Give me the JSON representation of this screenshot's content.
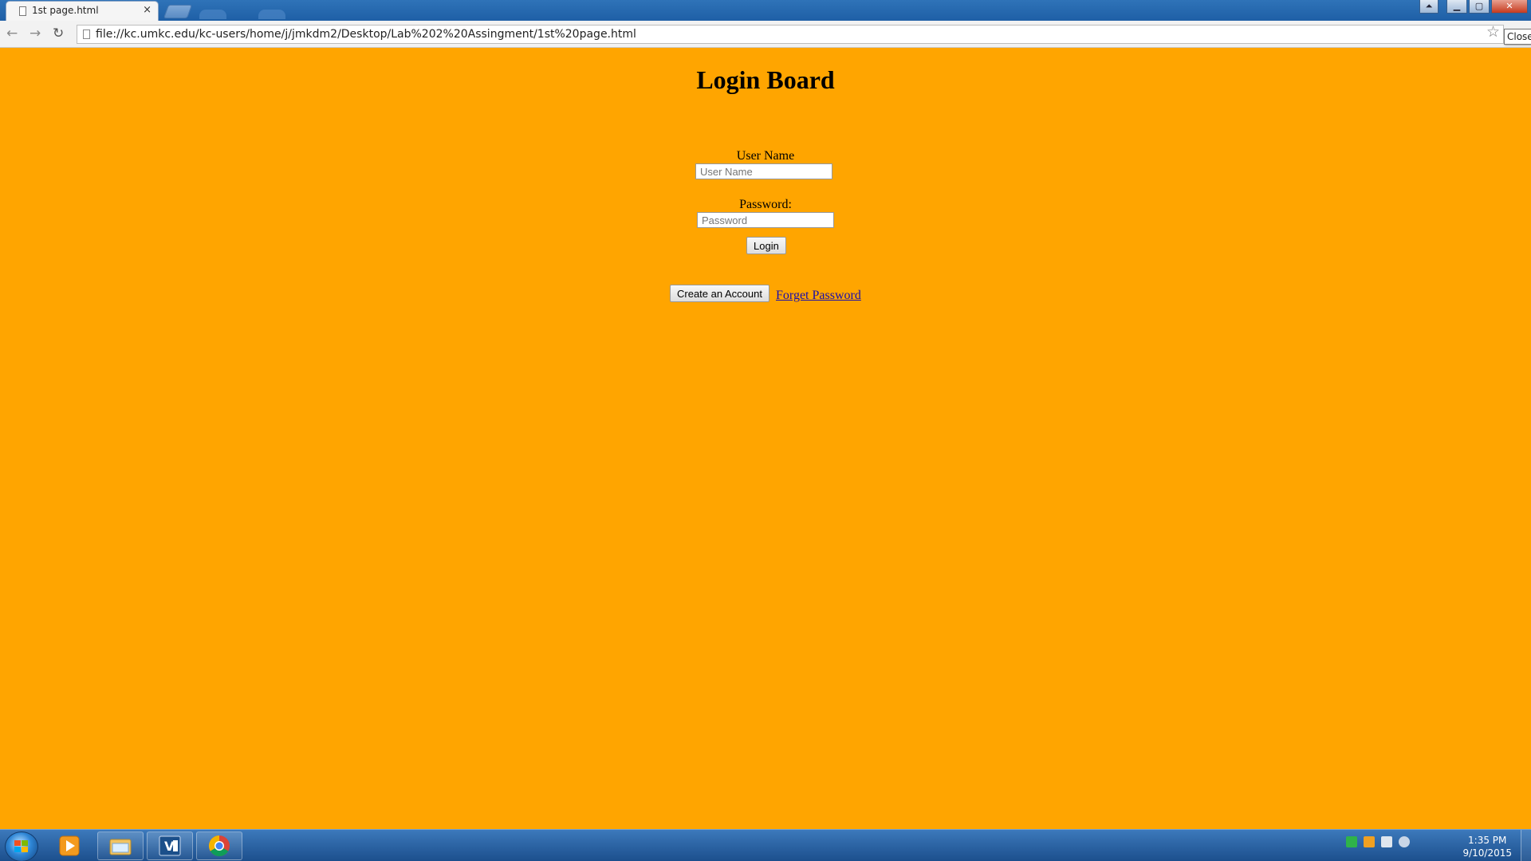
{
  "browser": {
    "tab_title": "1st page.html",
    "tab_close": "×",
    "url": "file://kc.umkc.edu/kc-users/home/j/jmkdm2/Desktop/Lab%202%20Assingment/1st%20page.html",
    "tooltip": "Close",
    "back_icon": "←",
    "forward_icon": "→",
    "reload_icon": "↻",
    "star_icon": "☆",
    "window_buttons": {
      "user": "⏶",
      "minimize": "▁",
      "maximize": "▢",
      "close": "✕"
    }
  },
  "page": {
    "title": "Login Board",
    "username_label": "User Name",
    "username_placeholder": "User Name",
    "password_label": "Password:",
    "password_placeholder": "Password",
    "login_button": "Login",
    "create_account_button": "Create an Account",
    "forgot_link": "Forget Password",
    "background_color": "#ffa500"
  },
  "taskbar": {
    "apps": [
      "media-player-icon",
      "file-explorer-icon",
      "visual-studio-icon",
      "chrome-icon"
    ],
    "tray_icons": [
      "network-icon",
      "shield-icon",
      "flag-icon",
      "volume-muted-icon"
    ],
    "time": "1:35 PM",
    "date": "9/10/2015"
  }
}
